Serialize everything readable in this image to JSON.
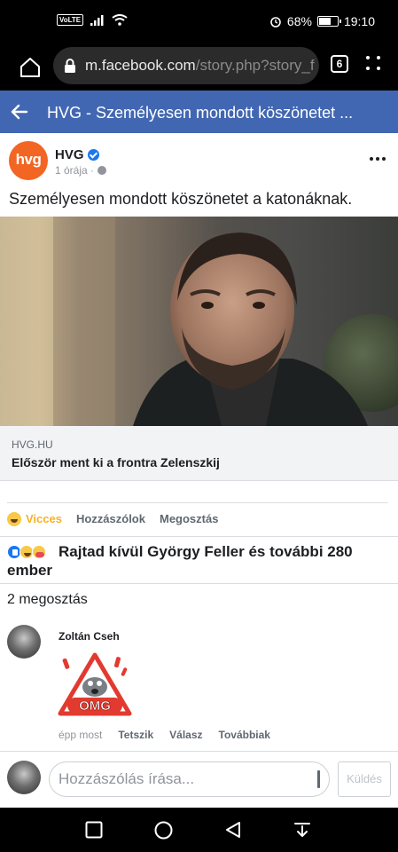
{
  "status_bar": {
    "network_badge": "VoLTE",
    "battery_percent": "68%",
    "battery_level": 0.68,
    "time": "19:10"
  },
  "browser": {
    "url_host": "m.facebook.com",
    "url_path": "/story.php?story_f",
    "tab_count": "6"
  },
  "fb_header": {
    "title": "HVG - Személyesen mondott köszönetet ..."
  },
  "post": {
    "page_name": "HVG",
    "avatar_text": "hvg",
    "time": "1 órája ·",
    "text": "Személyesen mondott köszönetet a katonáknak.",
    "link_domain": "HVG.HU",
    "link_title": "Először ment ki a frontra Zelenszkij"
  },
  "actions": {
    "react_label": "Vicces",
    "comment_label": "Hozzászólok",
    "share_label": "Megosztás"
  },
  "reactions_text": "Rajtad kívül György Feller és további 280 ember",
  "shares_text": "2 megosztás",
  "comment": {
    "author": "Zoltán Cseh",
    "sticker_text": "OMG",
    "time": "épp most",
    "like_label": "Tetszik",
    "reply_label": "Válasz",
    "more_label": "Továbbiak"
  },
  "composer": {
    "placeholder": "Hozzászólás írása...",
    "send_label": "Küldés"
  },
  "colors": {
    "fb_blue": "#4267b2",
    "hvg_orange": "#f26522",
    "haha_yellow": "#f7b125"
  }
}
